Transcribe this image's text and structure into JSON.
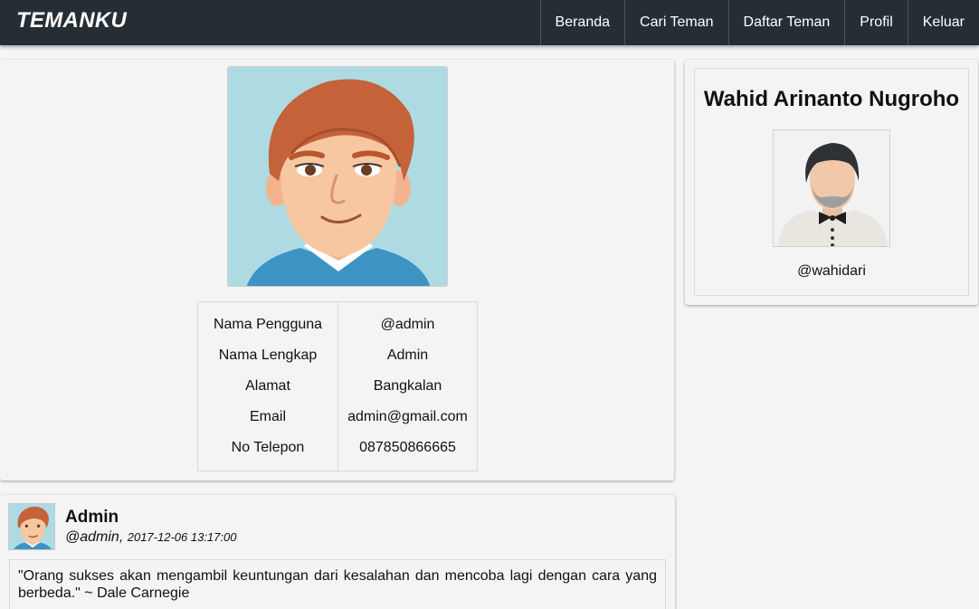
{
  "navbar": {
    "brand": "TEMANKU",
    "items": [
      "Beranda",
      "Cari Teman",
      "Daftar Teman",
      "Profil",
      "Keluar"
    ]
  },
  "profile": {
    "avatar_icon": "cartoon-man-avatar",
    "rows": [
      {
        "label": "Nama Pengguna",
        "value": "@admin"
      },
      {
        "label": "Nama Lengkap",
        "value": "Admin"
      },
      {
        "label": "Alamat",
        "value": "Bangkalan"
      },
      {
        "label": "Email",
        "value": "admin@gmail.com"
      },
      {
        "label": "No Telepon",
        "value": "087850866665"
      }
    ]
  },
  "post": {
    "author_name": "Admin",
    "author_username": "@admin",
    "separator": ",",
    "timestamp": "2017-12-06 13:17:00",
    "text": "\"Orang sukses akan mengambil keuntungan dari kesalahan dan mencoba lagi dengan cara yang berbeda.\" ~ Dale Carnegie"
  },
  "sidebar": {
    "name": "Wahid Arinanto Nugroho",
    "username": "@wahidari",
    "avatar_icon": "bearded-man-bowtie-avatar"
  },
  "colors": {
    "navbar_bg": "#262e35",
    "card_bg": "#f4f4f4",
    "avatar_bg": "#aedbe3"
  }
}
